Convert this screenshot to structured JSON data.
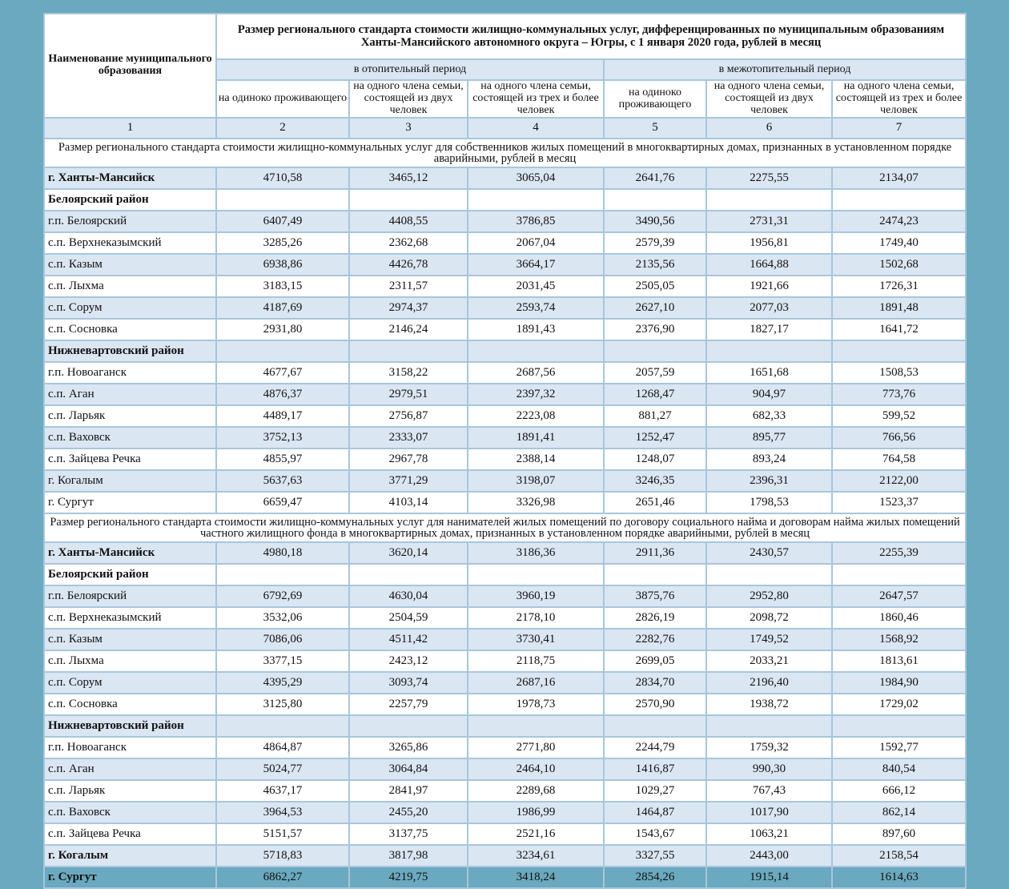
{
  "header": {
    "corner_label": "Наименование муниципального образования",
    "main_title": "Размер регионального стандарта стоимости жилищно-коммунальных услуг, дифференцированных по муниципальным образованиям Ханты-Мансийского автономного округа – Югры, с 1 января 2020 года, рублей в месяц",
    "period_heating": "в отопительный период",
    "period_nonheating": "в межотопительный период",
    "cols": [
      "на одиноко проживающего",
      "на одного члена семьи, состоящей из двух человек",
      "на одного члена семьи, состоящей из трех и более человек",
      "на одиноко проживающего",
      "на одного члена семьи, состоящей из двух человек",
      "на одного члена семьи, состоящей из трех и более человек"
    ],
    "indices": [
      "1",
      "2",
      "3",
      "4",
      "5",
      "6",
      "7"
    ]
  },
  "section1": {
    "title": "Размер регионального стандарта стоимости жилищно-коммунальных услуг для собственников жилых помещений в многоквартирных домах, признанных в установленном порядке аварийными, рублей в месяц",
    "rows": [
      {
        "name": "г. Ханты-Мансийск",
        "bold": true,
        "v": [
          "4710,58",
          "3465,12",
          "3065,04",
          "2641,76",
          "2275,55",
          "2134,07"
        ]
      },
      {
        "name": "Белоярский район",
        "bold": true,
        "v": [
          "",
          "",
          "",
          "",
          "",
          ""
        ]
      },
      {
        "name": "г.п. Белоярский",
        "bold": false,
        "v": [
          "6407,49",
          "4408,55",
          "3786,85",
          "3490,56",
          "2731,31",
          "2474,23"
        ]
      },
      {
        "name": "с.п. Верхнеказымский",
        "bold": false,
        "v": [
          "3285,26",
          "2362,68",
          "2067,04",
          "2579,39",
          "1956,81",
          "1749,40"
        ]
      },
      {
        "name": "с.п. Казым",
        "bold": false,
        "v": [
          "6938,86",
          "4426,78",
          "3664,17",
          "2135,56",
          "1664,88",
          "1502,68"
        ]
      },
      {
        "name": "с.п. Лыхма",
        "bold": false,
        "v": [
          "3183,15",
          "2311,57",
          "2031,45",
          "2505,05",
          "1921,66",
          "1726,31"
        ]
      },
      {
        "name": "с.п. Сорум",
        "bold": false,
        "v": [
          "4187,69",
          "2974,37",
          "2593,74",
          "2627,10",
          "2077,03",
          "1891,48"
        ]
      },
      {
        "name": "с.п. Сосновка",
        "bold": false,
        "v": [
          "2931,80",
          "2146,24",
          "1891,43",
          "2376,90",
          "1827,17",
          "1641,72"
        ]
      },
      {
        "name": "Нижневартовский район",
        "bold": true,
        "v": [
          "",
          "",
          "",
          "",
          "",
          ""
        ]
      },
      {
        "name": "г.п. Новоаганск",
        "bold": false,
        "v": [
          "4677,67",
          "3158,22",
          "2687,56",
          "2057,59",
          "1651,68",
          "1508,53"
        ]
      },
      {
        "name": "с.п. Аган",
        "bold": false,
        "v": [
          "4876,37",
          "2979,51",
          "2397,32",
          "1268,47",
          "904,97",
          "773,76"
        ]
      },
      {
        "name": "с.п. Ларьяк",
        "bold": false,
        "v": [
          "4489,17",
          "2756,87",
          "2223,08",
          "881,27",
          "682,33",
          "599,52"
        ]
      },
      {
        "name": "с.п. Ваховск",
        "bold": false,
        "v": [
          "3752,13",
          "2333,07",
          "1891,41",
          "1252,47",
          "895,77",
          "766,56"
        ]
      },
      {
        "name": "с.п. Зайцева Речка",
        "bold": false,
        "v": [
          "4855,97",
          "2967,78",
          "2388,14",
          "1248,07",
          "893,24",
          "764,58"
        ]
      },
      {
        "name": "г. Когалым",
        "bold": false,
        "v": [
          "5637,63",
          "3771,29",
          "3198,07",
          "3246,35",
          "2396,31",
          "2122,00"
        ]
      },
      {
        "name": "г. Сургут",
        "bold": false,
        "v": [
          "6659,47",
          "4103,14",
          "3326,98",
          "2651,46",
          "1798,53",
          "1523,37"
        ]
      }
    ]
  },
  "section2": {
    "title": "Размер регионального стандарта стоимости жилищно-коммунальных услуг для нанимателей жилых помещений по договору социального найма и договорам найма жилых помещений частного жилищного фонда в многоквартирных домах, признанных в установленном порядке аварийными, рублей в месяц",
    "rows": [
      {
        "name": "г. Ханты-Мансийск",
        "bold": true,
        "v": [
          "4980,18",
          "3620,14",
          "3186,36",
          "2911,36",
          "2430,57",
          "2255,39"
        ]
      },
      {
        "name": "Белоярский район",
        "bold": true,
        "v": [
          "",
          "",
          "",
          "",
          "",
          ""
        ]
      },
      {
        "name": "г.п. Белоярский",
        "bold": false,
        "v": [
          "6792,69",
          "4630,04",
          "3960,19",
          "3875,76",
          "2952,80",
          "2647,57"
        ]
      },
      {
        "name": "с.п. Верхнеказымский",
        "bold": false,
        "v": [
          "3532,06",
          "2504,59",
          "2178,10",
          "2826,19",
          "2098,72",
          "1860,46"
        ]
      },
      {
        "name": "с.п. Казым",
        "bold": false,
        "v": [
          "7086,06",
          "4511,42",
          "3730,41",
          "2282,76",
          "1749,52",
          "1568,92"
        ]
      },
      {
        "name": "с.п. Лыхма",
        "bold": false,
        "v": [
          "3377,15",
          "2423,12",
          "2118,75",
          "2699,05",
          "2033,21",
          "1813,61"
        ]
      },
      {
        "name": "с.п. Сорум",
        "bold": false,
        "v": [
          "4395,29",
          "3093,74",
          "2687,16",
          "2834,70",
          "2196,40",
          "1984,90"
        ]
      },
      {
        "name": "с.п. Сосновка",
        "bold": false,
        "v": [
          "3125,80",
          "2257,79",
          "1978,73",
          "2570,90",
          "1938,72",
          "1729,02"
        ]
      },
      {
        "name": "Нижневартовский район",
        "bold": true,
        "v": [
          "",
          "",
          "",
          "",
          "",
          ""
        ]
      },
      {
        "name": "г.п. Новоаганск",
        "bold": false,
        "v": [
          "4864,87",
          "3265,86",
          "2771,80",
          "2244,79",
          "1759,32",
          "1592,77"
        ]
      },
      {
        "name": "с.п. Аган",
        "bold": false,
        "v": [
          "5024,77",
          "3064,84",
          "2464,10",
          "1416,87",
          "990,30",
          "840,54"
        ]
      },
      {
        "name": "с.п. Ларьяк",
        "bold": false,
        "v": [
          "4637,17",
          "2841,97",
          "2289,68",
          "1029,27",
          "767,43",
          "666,12"
        ]
      },
      {
        "name": "с.п. Ваховск",
        "bold": false,
        "v": [
          "3964,53",
          "2455,20",
          "1986,99",
          "1464,87",
          "1017,90",
          "862,14"
        ]
      },
      {
        "name": "с.п. Зайцева Речка",
        "bold": false,
        "v": [
          "5151,57",
          "3137,75",
          "2521,16",
          "1543,67",
          "1063,21",
          "897,60"
        ]
      },
      {
        "name": "г. Когалым",
        "bold": true,
        "v": [
          "5718,83",
          "3817,98",
          "3234,61",
          "3327,55",
          "2443,00",
          "2158,54"
        ]
      },
      {
        "name": "г. Сургут",
        "bold": true,
        "v": [
          "6862,27",
          "4219,75",
          "3418,24",
          "2854,26",
          "1915,14",
          "1614,63"
        ]
      }
    ]
  }
}
